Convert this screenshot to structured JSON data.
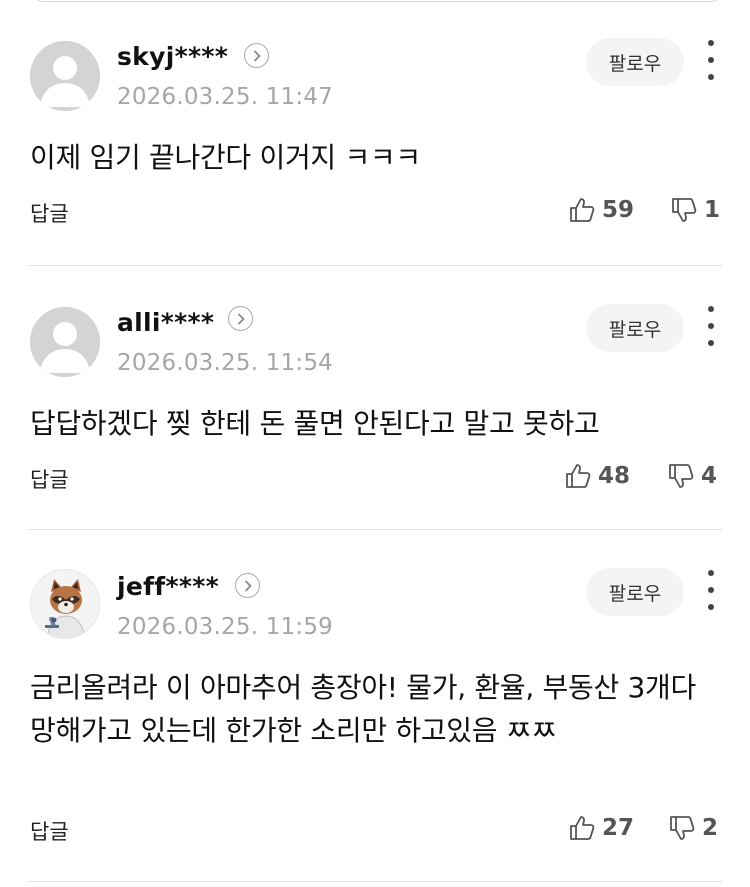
{
  "comments": [
    {
      "username": "skyj****",
      "timestamp": "2026.03.25. 11:47",
      "follow_label": "팔로우",
      "body": "이제 임기 끝나간다 이거지 ㅋㅋㅋ",
      "reply_label": "답글",
      "likes": "59",
      "dislikes": "1",
      "avatar": "default-person-icon"
    },
    {
      "username": "alli****",
      "timestamp": "2026.03.25. 11:54",
      "follow_label": "팔로우",
      "body": "답답하겠다 찢 한테 돈 풀면 안된다고 말고 못하고",
      "reply_label": "답글",
      "likes": "48",
      "dislikes": "4",
      "avatar": "default-person-icon"
    },
    {
      "username": "jeff****",
      "timestamp": "2026.03.25. 11:59",
      "follow_label": "팔로우",
      "body": "금리올려라 이 아마추어 총장아! 물가, 환율, 부동산 3개다 망해가고 있는데 한가한 소리만 하고있음 ㅉㅉ",
      "reply_label": "답글",
      "likes": "27",
      "dislikes": "2",
      "avatar": "raccoon-avatar"
    }
  ],
  "colors": {
    "text": "#111111",
    "timestamp": "#a6a6a6",
    "follow_bg": "#f4f4f5",
    "divider": "#e5e5e5",
    "avatar_placeholder": "#d4d4d4"
  }
}
